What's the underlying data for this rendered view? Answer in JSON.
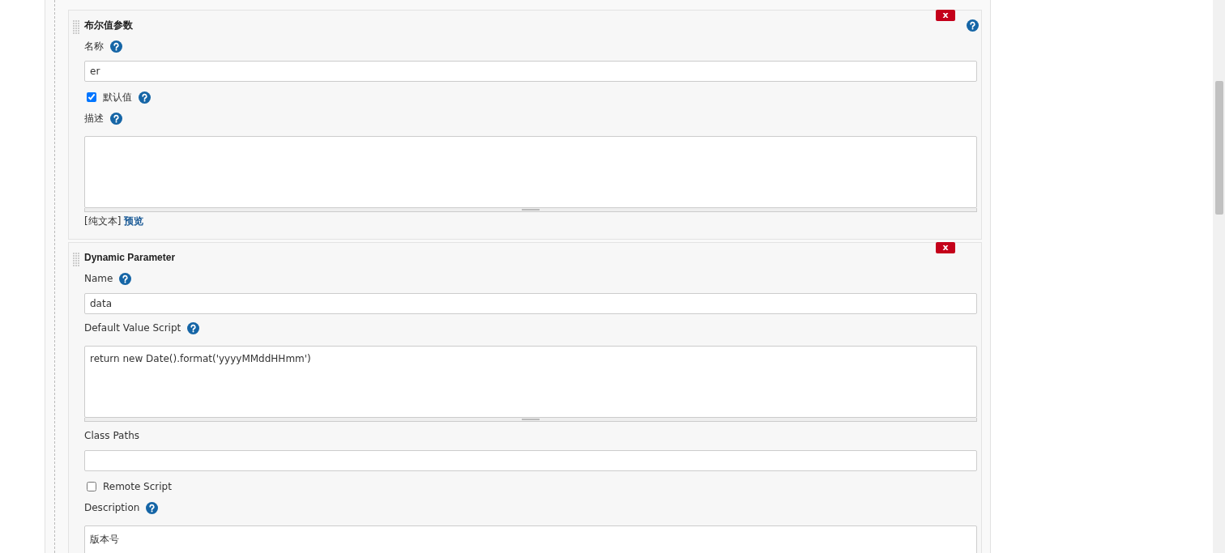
{
  "parameters": [
    {
      "title": "布尔值参数",
      "help": true,
      "delete_label": "x",
      "fields": [
        {
          "kind": "text",
          "label": "名称",
          "help": true,
          "value": "er"
        },
        {
          "kind": "checkbox",
          "label": "默认值",
          "help": true,
          "checked": true
        },
        {
          "kind": "textarea",
          "label": "描述",
          "help": true
        },
        {
          "kind": "format",
          "format": "[纯文本]",
          "link": "预览"
        }
      ]
    },
    {
      "title": "Dynamic Parameter",
      "help": false,
      "delete_label": "x",
      "fields": [
        {
          "kind": "text",
          "label": "Name",
          "help": true,
          "value": "data"
        },
        {
          "kind": "textarea",
          "label": "Default Value Script",
          "help": true,
          "value": "return new Date().format('yyyyMMddHHmm')"
        },
        {
          "kind": "text",
          "label": "Class Paths",
          "help": false
        },
        {
          "kind": "checkbox",
          "label": "Remote Script",
          "help": false,
          "checked": false
        },
        {
          "kind": "textarea",
          "label": "Description",
          "help": true,
          "value": "版本号"
        }
      ]
    }
  ]
}
